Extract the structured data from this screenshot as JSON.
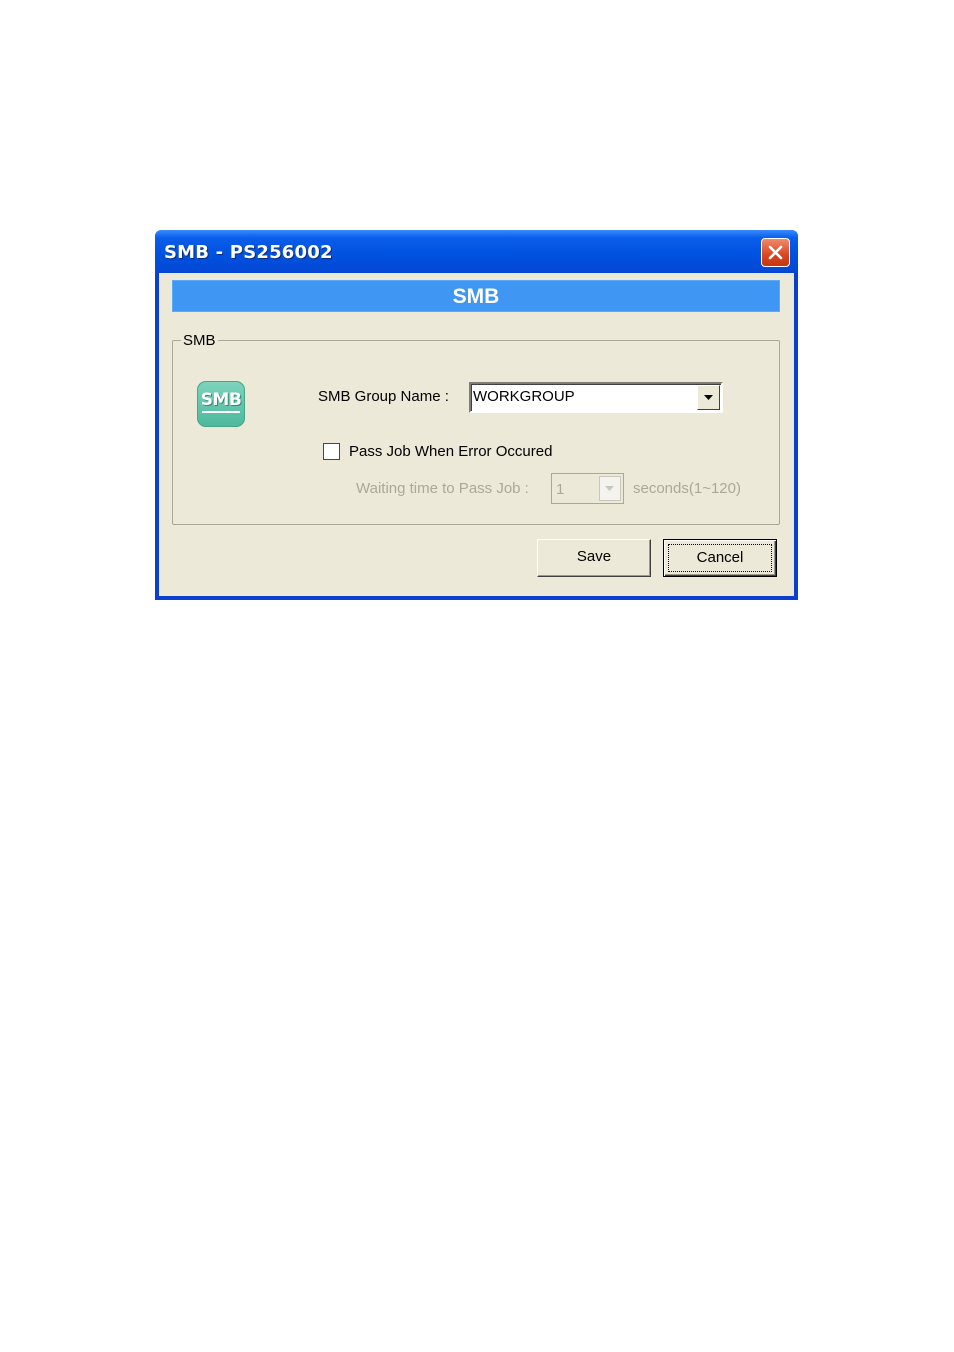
{
  "window": {
    "title": "SMB - PS256002"
  },
  "banner": {
    "title": "SMB"
  },
  "group": {
    "legend": "SMB",
    "logo_text": "SMB",
    "group_name_label": "SMB Group Name :",
    "group_name_value": "WORKGROUP",
    "pass_job_label": "Pass Job When Error Occured",
    "pass_job_checked": false,
    "waiting_label": "Waiting time to Pass Job :",
    "waiting_value": "1",
    "waiting_unit": "seconds(1~120)"
  },
  "buttons": {
    "save": "Save",
    "cancel": "Cancel"
  },
  "colors": {
    "titlebar": "#0052e0",
    "banner": "#3f97f3",
    "dialog_bg": "#ece9d8",
    "logo": "#5bc0a6",
    "disabled_text": "#aca899"
  },
  "icons": {
    "close": "close-icon",
    "dropdown": "chevron-down-icon",
    "logo": "smb-logo-icon"
  }
}
